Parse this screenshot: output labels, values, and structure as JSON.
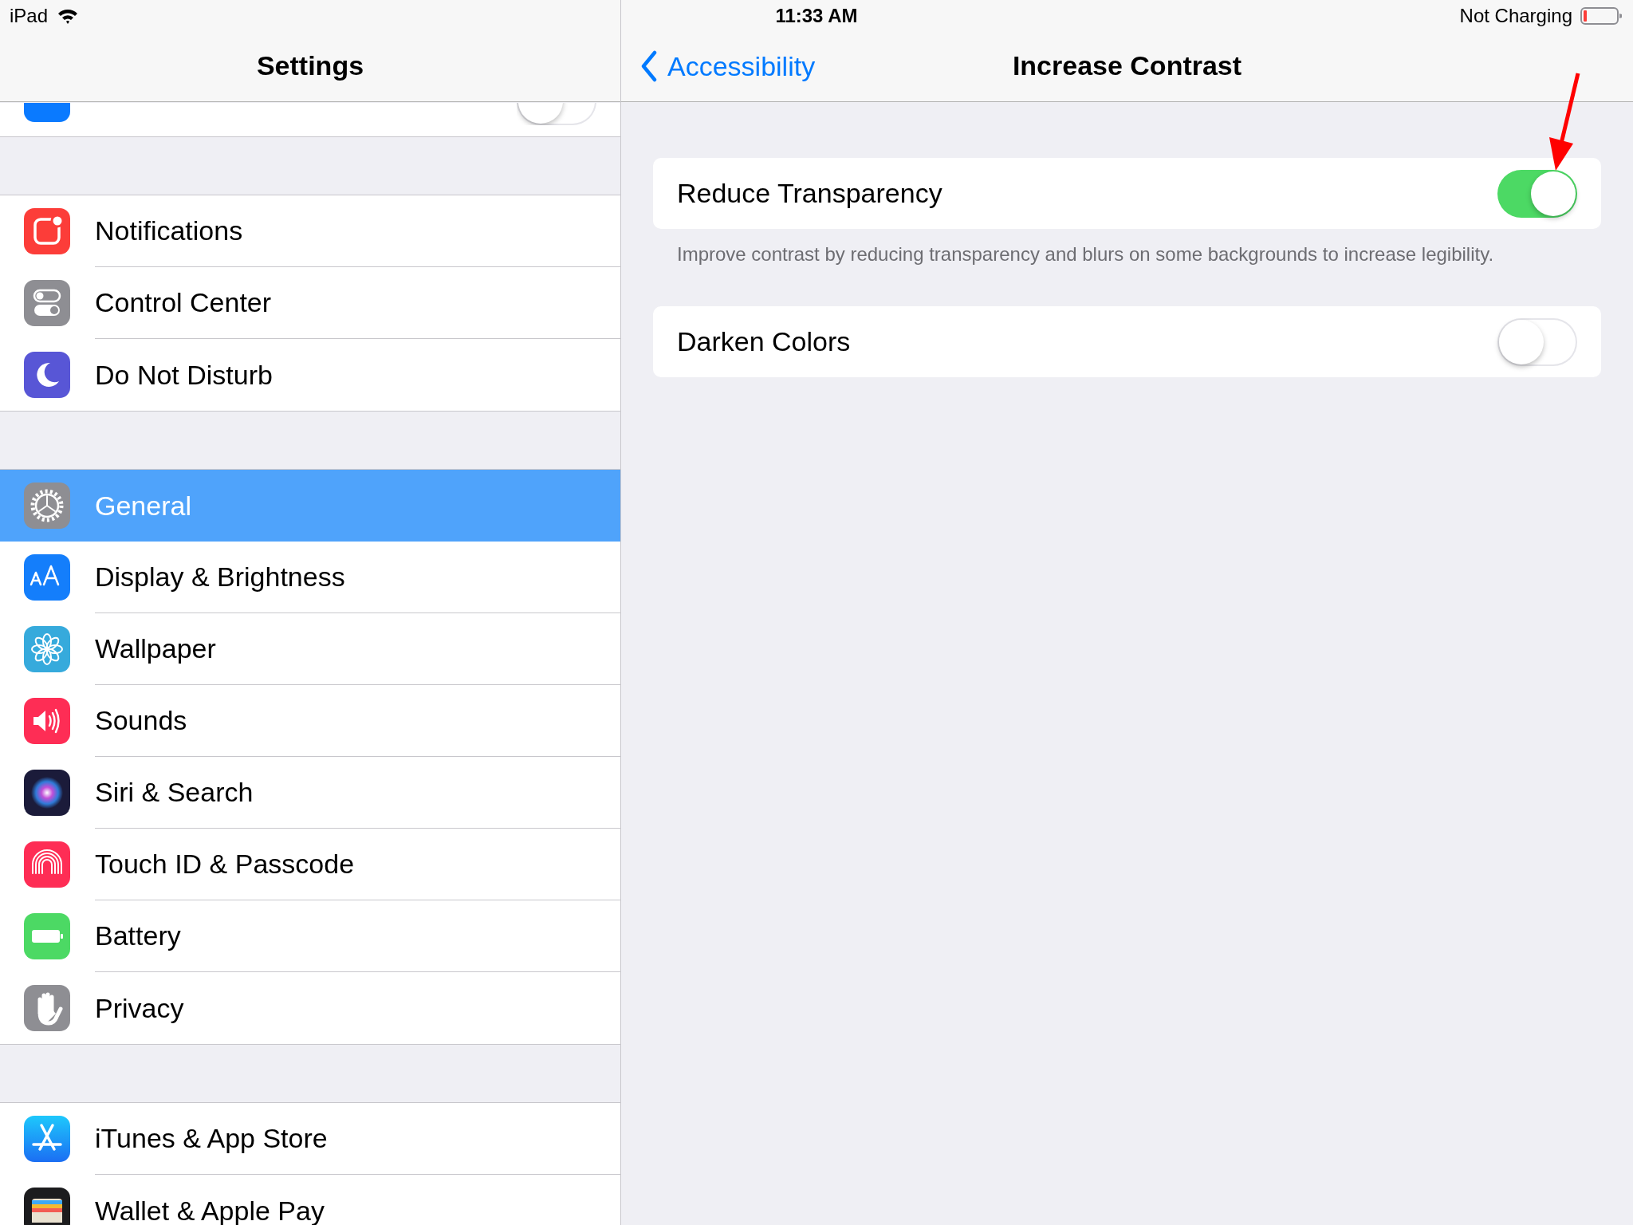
{
  "status_bar": {
    "device": "iPad",
    "time": "11:33 AM",
    "battery_text": "Not Charging"
  },
  "sidebar": {
    "title": "Settings",
    "groups": [
      [
        {
          "kind": "toggle",
          "on": false,
          "selected": false
        }
      ],
      [
        {
          "label": "Notifications",
          "kind": "link",
          "selected": false
        },
        {
          "label": "Control Center",
          "kind": "link",
          "selected": false
        },
        {
          "label": "Do Not Disturb",
          "kind": "link",
          "selected": false
        }
      ],
      [
        {
          "label": "General",
          "kind": "link",
          "selected": true
        },
        {
          "label": "Display & Brightness",
          "kind": "link",
          "selected": false
        },
        {
          "label": "Wallpaper",
          "kind": "link",
          "selected": false
        },
        {
          "label": "Sounds",
          "kind": "link",
          "selected": false
        },
        {
          "label": "Siri & Search",
          "kind": "link",
          "selected": false
        },
        {
          "label": "Touch ID & Passcode",
          "kind": "link",
          "selected": false
        },
        {
          "label": "Battery",
          "kind": "link",
          "selected": false
        },
        {
          "label": "Privacy",
          "kind": "link",
          "selected": false
        }
      ],
      [
        {
          "label": "iTunes & App Store",
          "kind": "link",
          "selected": false
        },
        {
          "label": "Wallet & Apple Pay",
          "kind": "link",
          "selected": false
        }
      ]
    ]
  },
  "detail": {
    "back": "Accessibility",
    "title": "Increase Contrast",
    "settings": [
      {
        "label": "Reduce Transparency",
        "on": true,
        "footer": "Improve contrast by reducing transparency and blurs on some backgrounds to increase legibility."
      },
      {
        "label": "Darken Colors",
        "on": false
      }
    ]
  }
}
